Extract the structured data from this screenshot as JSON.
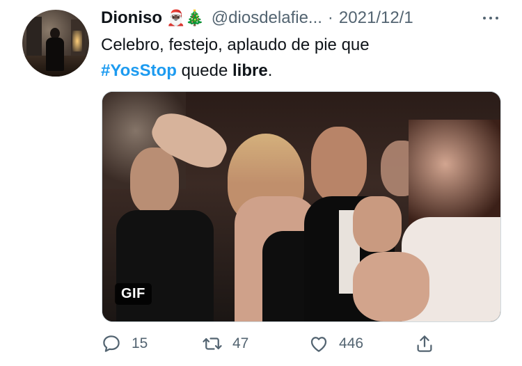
{
  "tweet": {
    "author_name": "Dioniso",
    "author_emojis": "🎅🏿🎄",
    "handle": "@diosdelafie...",
    "separator": "·",
    "date": "2021/12/1",
    "text_before": "Celebro, festejo, aplaudo de pie que",
    "hashtag": "#YosStop",
    "text_mid": "quede",
    "text_bold": "libre",
    "text_end": ".",
    "media_badge": "GIF",
    "actions": {
      "replies": "15",
      "retweets": "47",
      "likes": "446"
    }
  },
  "icons": [
    "more-icon",
    "reply-icon",
    "retweet-icon",
    "like-icon",
    "share-icon"
  ],
  "colors": {
    "hashtag": "#1d9bf0",
    "secondary_text": "#536471"
  }
}
